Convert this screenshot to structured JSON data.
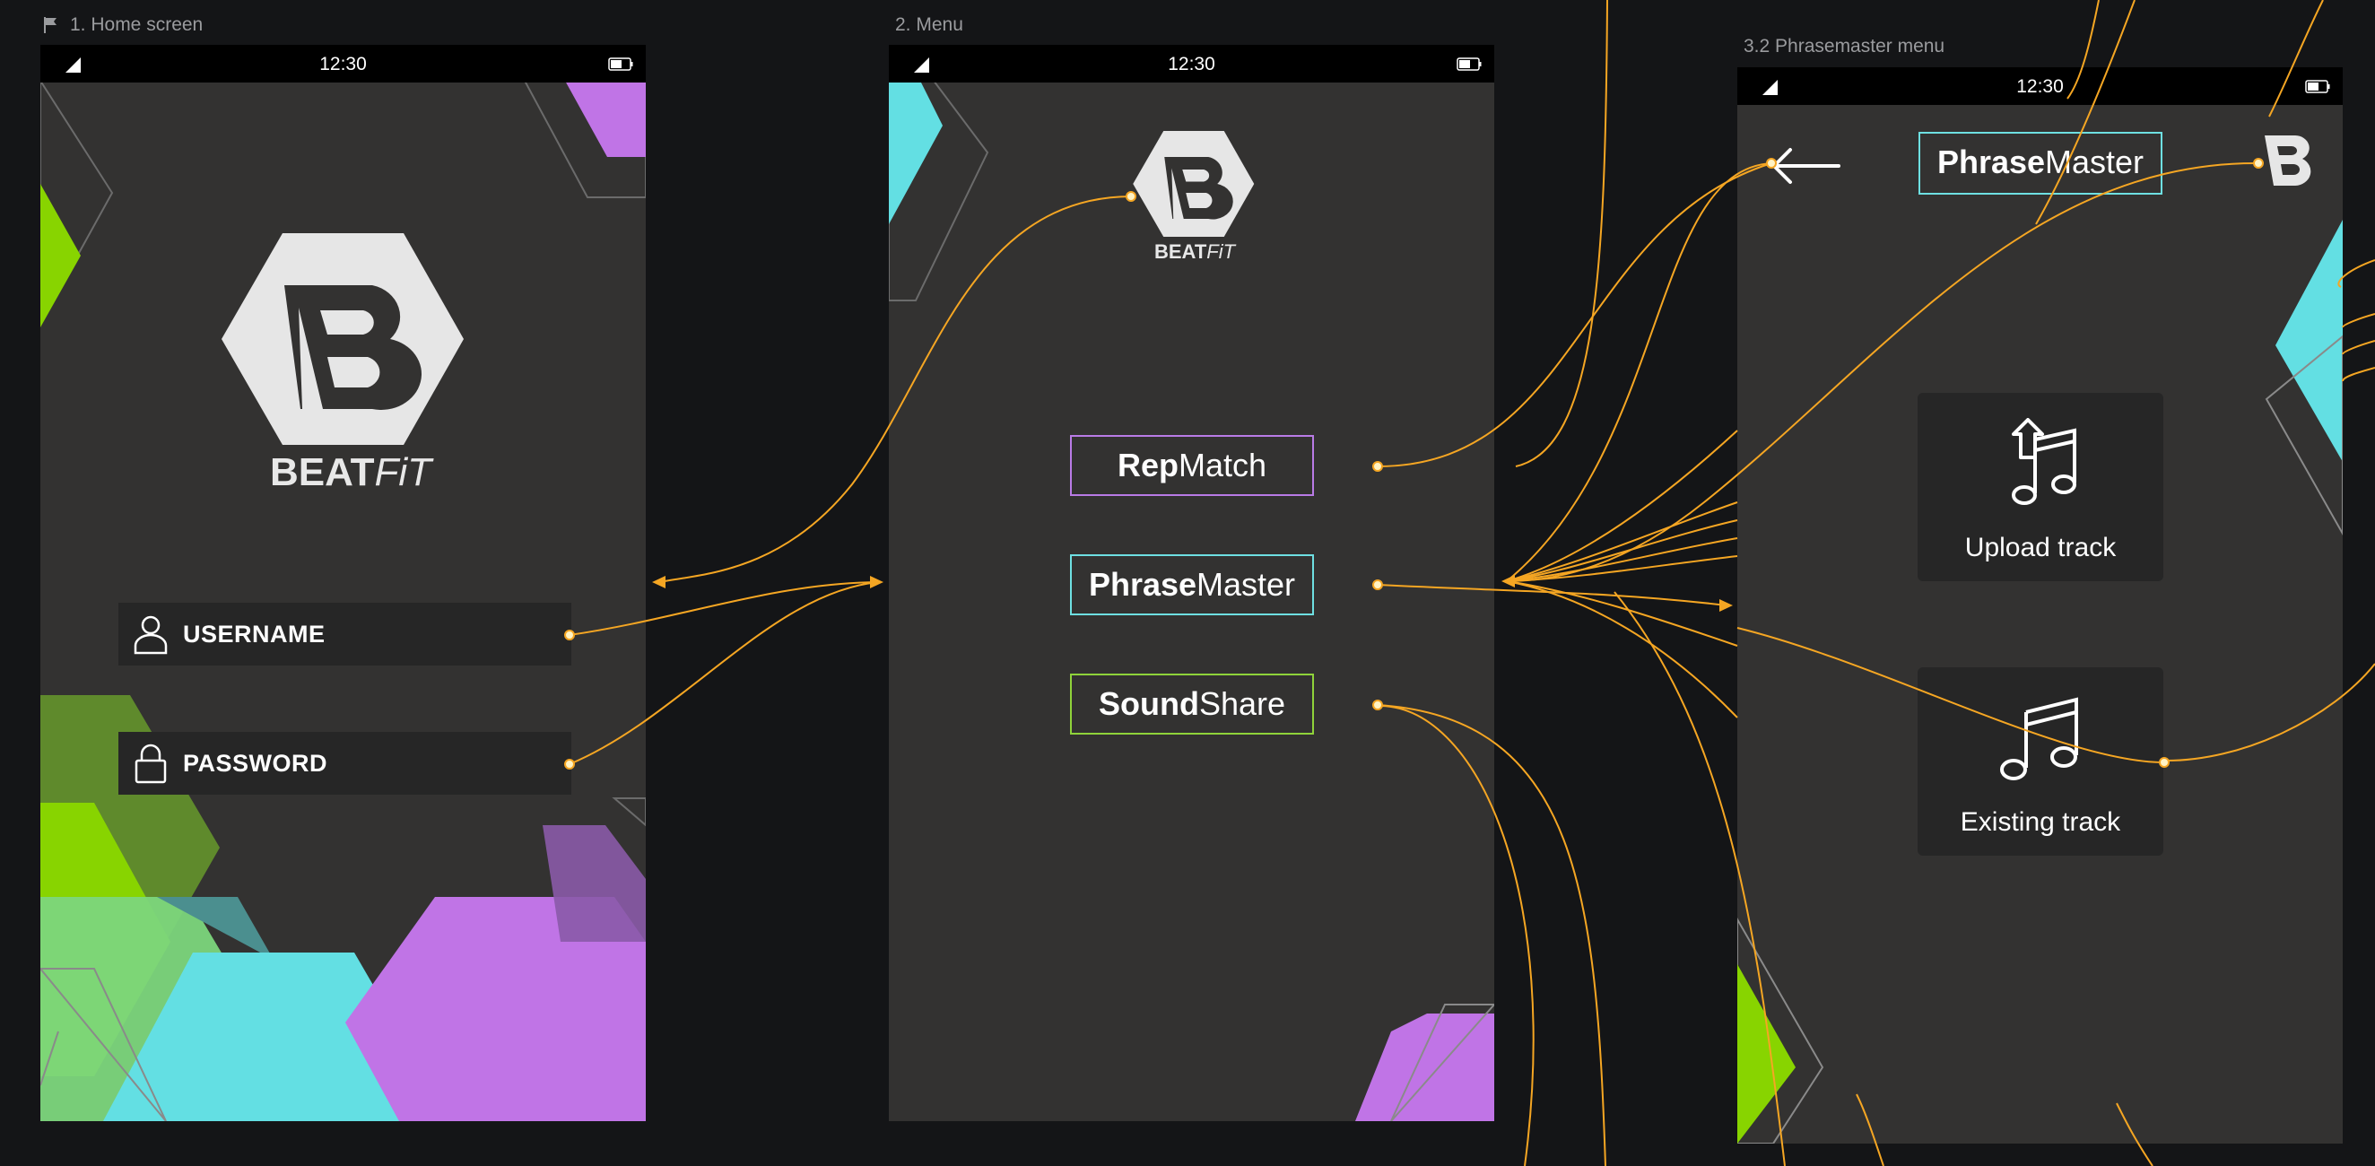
{
  "frames": [
    {
      "label": "1. Home screen"
    },
    {
      "label": "2. Menu"
    },
    {
      "label": "3.2 Phrasemaster menu"
    }
  ],
  "status_bar": {
    "time": "12:30"
  },
  "brand": {
    "name_bold": "BEAT",
    "name_italic": "FiT",
    "logo_letter": "B"
  },
  "home": {
    "username_label": "USERNAME",
    "password_label": "PASSWORD"
  },
  "menu": {
    "items": [
      {
        "bold": "Rep",
        "light": "Match",
        "border_color": "#b97be6"
      },
      {
        "bold": "Phrase",
        "light": "Master",
        "border_color": "#6ee0e2"
      },
      {
        "bold": "Sound",
        "light": "Share",
        "border_color": "#8fd33a"
      }
    ]
  },
  "phrasemaster": {
    "header_bold": "Phrase",
    "header_light": "Master",
    "tiles": [
      {
        "label": "Upload track",
        "icon": "upload-music-icon"
      },
      {
        "label": "Existing track",
        "icon": "music-notes-icon"
      }
    ]
  },
  "colors": {
    "background": "#141517",
    "phone_bg": "#333231",
    "connector": "#f5a623",
    "purple": "#c074e6",
    "cyan": "#63dfe3",
    "green": "#88d400",
    "dark_green": "#5f8a2c"
  }
}
